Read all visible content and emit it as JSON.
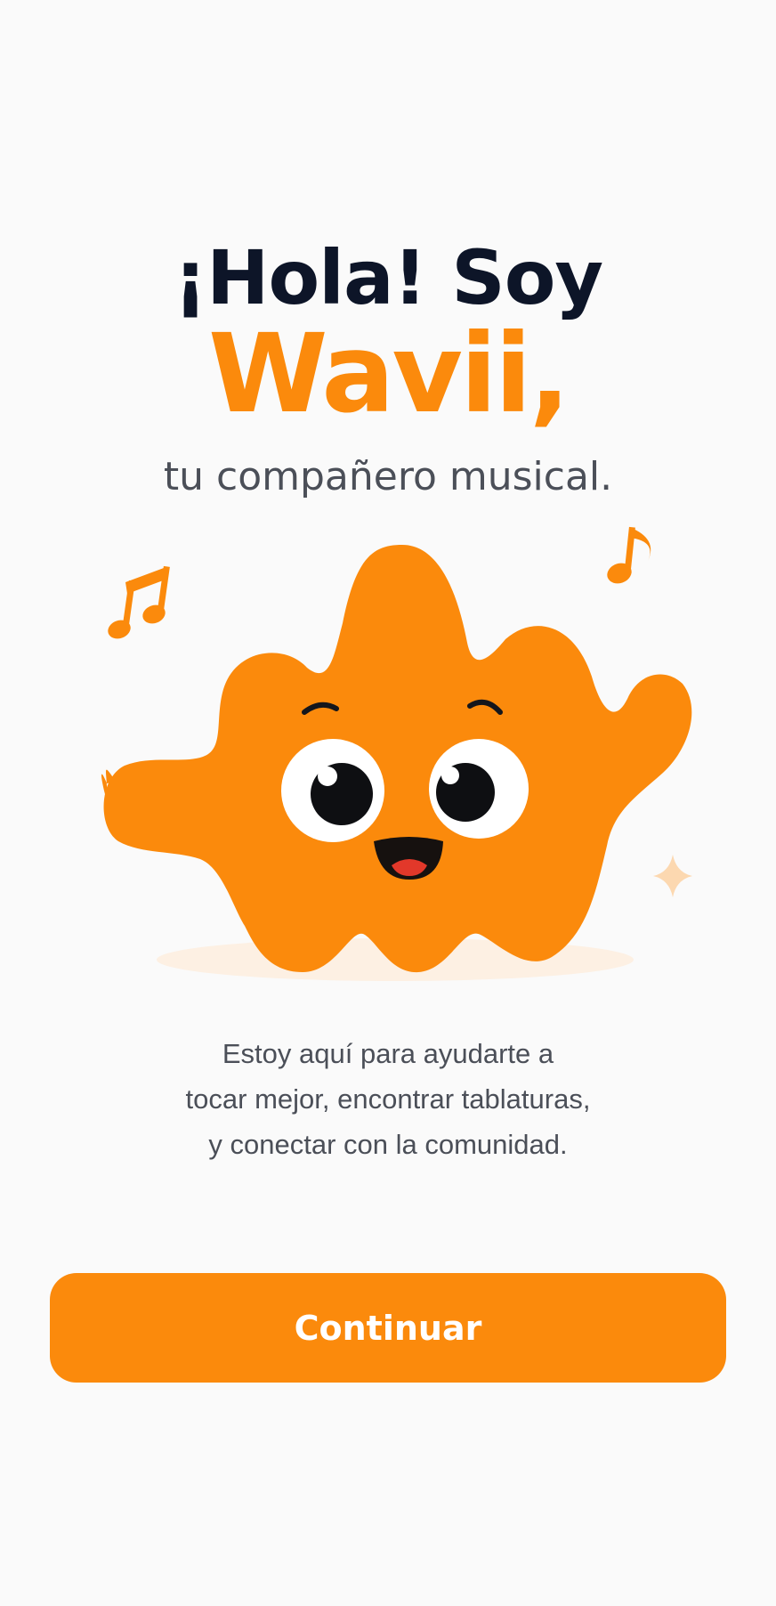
{
  "welcome": {
    "greeting": "¡Hola! Soy",
    "brand_name": "Wavii,",
    "tagline": "tu compañero musical."
  },
  "description": {
    "lines": [
      "Estoy aquí para ayudarte a",
      "tocar mejor, encontrar tablaturas,",
      "y conectar con la comunidad."
    ]
  },
  "actions": {
    "continue_label": "Continuar"
  },
  "colors": {
    "brand_orange": "#fb8a0c",
    "title_dark": "#0d1528",
    "body_gray": "#4b4f58",
    "background": "#fafafa"
  },
  "icons": {
    "left_note": "music-note-icon",
    "right_note": "music-note-icon",
    "sparkle": "sparkle-icon"
  }
}
